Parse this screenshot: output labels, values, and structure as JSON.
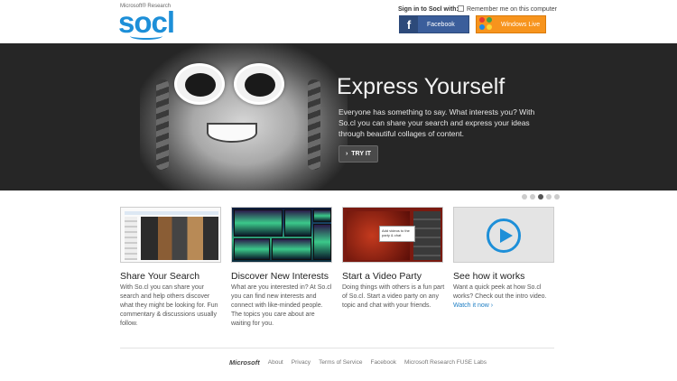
{
  "header": {
    "brand_sub": "Microsoft® Research",
    "logo": "socl",
    "signin_label": "Sign in to Socl with:",
    "remember_label": "Remember me on this computer",
    "facebook_label": "Facebook",
    "windows_live_label": "Windows Live"
  },
  "hero": {
    "title": "Express Yourself",
    "text": "Everyone has something to say. What interests you? With So.cl you can share your search and express your ideas through beautiful collages of content.",
    "try_label": "TRY IT",
    "slides": 5,
    "active_slide": 3
  },
  "features": [
    {
      "title": "Share Your Search",
      "desc": "With So.cl you can share your search and help others discover what they might be looking for. Fun commentary & discussions usually follow."
    },
    {
      "title": "Discover New Interests",
      "desc": "What are you interested in? At So.cl you can find new interests and connect with like-minded people. The topics you care about are waiting for you."
    },
    {
      "title": "Start a Video Party",
      "desc": "Doing things with others is a fun part of So.cl. Start a video party on any topic and chat with your friends.",
      "tooltip": "Add videos to the party & chat"
    },
    {
      "title": "See how it works",
      "desc": "Want a quick peek at how So.cl works? Check out the intro video.",
      "link": "Watch it now ›"
    }
  ],
  "footer": {
    "logo": "Microsoft",
    "links": [
      "About",
      "Privacy",
      "Terms of Service",
      "Facebook",
      "Microsoft Research FUSE Labs"
    ]
  },
  "colors": {
    "brand_blue": "#1d8fd8",
    "facebook": "#3b5e9b",
    "windows_live": "#f7941d",
    "hero_bg": "#262626"
  }
}
